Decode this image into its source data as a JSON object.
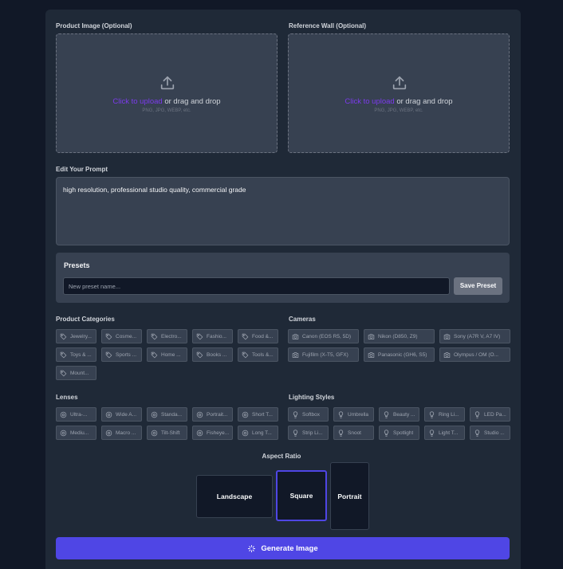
{
  "upload": {
    "product": {
      "label": "Product Image (Optional)",
      "link": "Click to upload",
      "rest": " or drag and drop",
      "hint": "PNG, JPG, WEBP, etc."
    },
    "wall": {
      "label": "Reference Wall (Optional)",
      "link": "Click to upload",
      "rest": " or drag and drop",
      "hint": "PNG, JPG, WEBP, etc."
    }
  },
  "prompt": {
    "label": "Edit Your Prompt",
    "value": "high resolution, professional studio quality, commercial grade"
  },
  "presets": {
    "title": "Presets",
    "placeholder": "New preset name...",
    "save_label": "Save Preset"
  },
  "categories": {
    "title": "Product Categories",
    "items": [
      "Jewelry...",
      "Cosme...",
      "Electro...",
      "Fashio...",
      "Food &...",
      "Toys & ...",
      "Sports ...",
      "Home ...",
      "Books ...",
      "Tools &...",
      "Mount..."
    ]
  },
  "cameras": {
    "title": "Cameras",
    "items": [
      "Canon (EOS R5, 5D)",
      "Nikon (D850, Z9)",
      "Sony (A7R V, A7 IV)",
      "Fujifilm (X-T5, GFX)",
      "Panasonic (GH6, S5)",
      "Olympus / OM (O..."
    ]
  },
  "lenses": {
    "title": "Lenses",
    "items": [
      "Ultra-...",
      "Wide A...",
      "Standa...",
      "Portrait...",
      "Short T...",
      "Mediu...",
      "Macro ...",
      "Tilt-Shift",
      "Fisheye...",
      "Long T..."
    ]
  },
  "lighting": {
    "title": "Lighting Styles",
    "items": [
      "Softbox",
      "Umbrella",
      "Beauty ...",
      "Ring Li...",
      "LED Pa...",
      "Strip Li...",
      "Snoot",
      "Spotlight",
      "Light T...",
      "Studio ..."
    ]
  },
  "aspect": {
    "title": "Aspect Ratio",
    "landscape": "Landscape",
    "square": "Square",
    "portrait": "Portrait",
    "selected": "Square"
  },
  "generate": {
    "label": "Generate Image",
    "icon": "sparkle-icon"
  },
  "colors": {
    "accent": "#4f46e5",
    "link": "#7c3aed",
    "bg": "#111827",
    "panel": "#1f2937"
  }
}
